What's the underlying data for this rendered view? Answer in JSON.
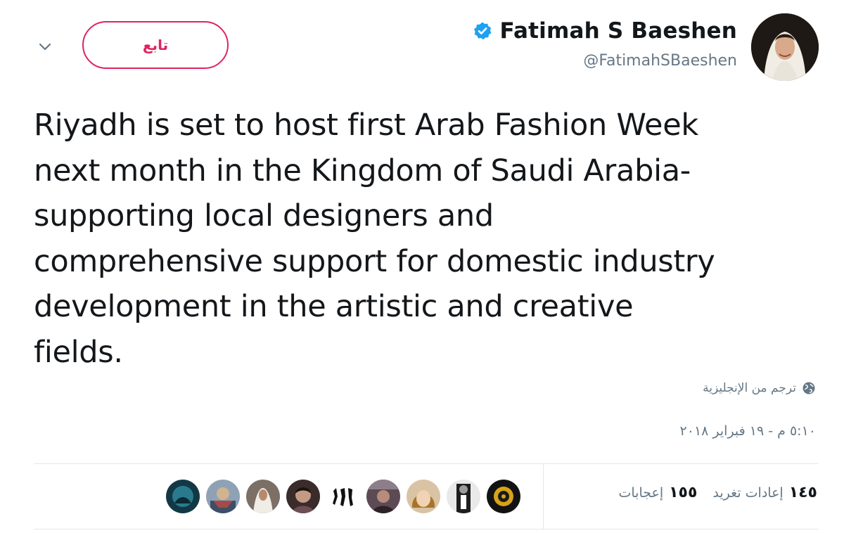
{
  "header": {
    "follow_label": "تابع",
    "display_name": "Fatimah S Baeshen",
    "handle": "@FatimahSBaeshen",
    "verified_icon": "verified-badge-icon",
    "menu_icon": "chevron-down-icon"
  },
  "tweet": {
    "text": "Riyadh is set to host first Arab Fashion Week\nnext month in the Kingdom of Saudi Arabia-\nsupporting local designers and\ncomprehensive support for domestic industry\ndevelopment in the artistic and creative\nfields."
  },
  "translate": {
    "label": "ترجم من الإنجليزية",
    "icon": "globe-icon"
  },
  "timestamp": "٥:١٠ م - ١٩ فبراير ٢٠١٨",
  "stats": {
    "retweets_count": "١٤٥",
    "retweets_label": "إعادات تغريد",
    "likes_count": "١٥٥",
    "likes_label": "إعجابات"
  },
  "likers": [
    {
      "name": "liker-avatar-1",
      "color": "#1d4f61"
    },
    {
      "name": "liker-avatar-2",
      "color": "#6a7f95"
    },
    {
      "name": "liker-avatar-3",
      "color": "#8a7b6f"
    },
    {
      "name": "liker-avatar-4",
      "color": "#4a3b3a"
    },
    {
      "name": "liker-avatar-5",
      "color": "#ffffff"
    },
    {
      "name": "liker-avatar-6",
      "color": "#5a4a52"
    },
    {
      "name": "liker-avatar-7",
      "color": "#c7a47a"
    },
    {
      "name": "liker-avatar-8",
      "color": "#2b2b2b"
    },
    {
      "name": "liker-avatar-9",
      "color": "#d8a21a"
    }
  ],
  "colors": {
    "follow_accent": "#e0245e",
    "verified_blue": "#1da1f2",
    "muted_text": "#657786",
    "primary_text": "#14171a",
    "divider": "#e1e8ed"
  }
}
